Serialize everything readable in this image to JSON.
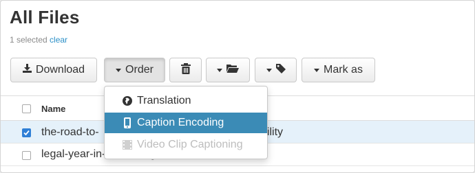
{
  "page": {
    "title": "All Files"
  },
  "selection": {
    "text": "1 selected",
    "clear_label": "clear"
  },
  "toolbar": {
    "download_label": "Download",
    "order_label": "Order",
    "mark_as_label": "Mark as"
  },
  "icons": {
    "download": "download-icon",
    "trash": "trash-icon",
    "folder": "folder-icon",
    "tag": "tag-icon",
    "globe": "globe-icon",
    "mobile": "mobile-icon",
    "film": "film-icon"
  },
  "table": {
    "header": {
      "name": "Name"
    },
    "rows": [
      {
        "name_visible_start": "the-road-to-",
        "name_visible_end": "bility",
        "checked": true
      },
      {
        "name": "legal-year-in-review-digital-access-cases",
        "checked": false
      }
    ]
  },
  "order_menu": {
    "items": [
      {
        "label": "Translation",
        "state": "normal"
      },
      {
        "label": "Caption Encoding",
        "state": "hover"
      },
      {
        "label": "Video Clip Captioning",
        "state": "disabled"
      }
    ]
  },
  "colors": {
    "link": "#2a8fc7",
    "menu_hover": "#3b8bb6",
    "selected_row": "#e5f1fa",
    "checkbox": "#2f7fd6"
  }
}
